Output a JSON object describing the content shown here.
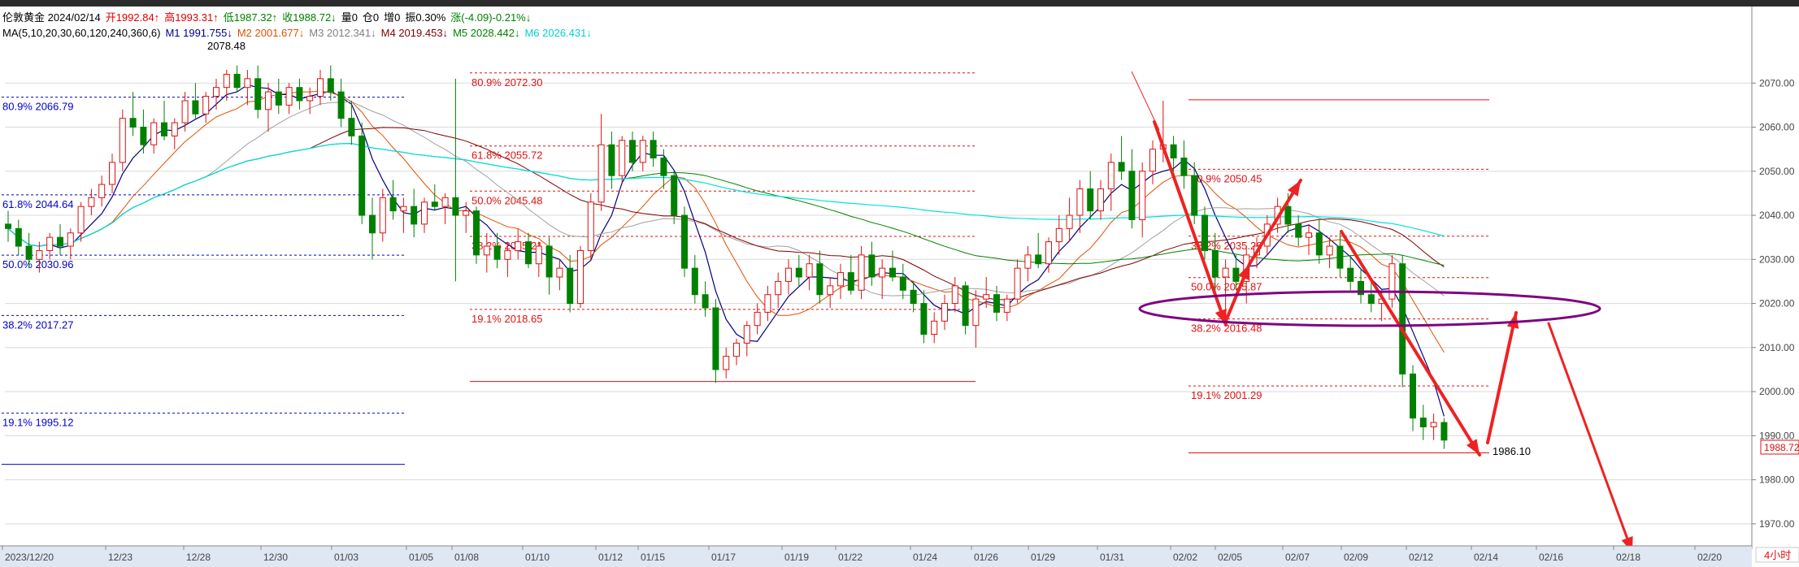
{
  "info": {
    "line1": [
      {
        "text": "伦敦黄金 2024/02/14",
        "color": "#000000"
      },
      {
        "text": "开1992.84↑",
        "color": "#e00000"
      },
      {
        "text": "高1993.31↑",
        "color": "#e00000"
      },
      {
        "text": "低1987.32↑",
        "color": "#008000"
      },
      {
        "text": "收1988.72↓",
        "color": "#008000"
      },
      {
        "text": "量0",
        "color": "#000000"
      },
      {
        "text": "仓0",
        "color": "#000000"
      },
      {
        "text": "增0",
        "color": "#000000"
      },
      {
        "text": "振0.30%",
        "color": "#000000"
      },
      {
        "text": "涨(-4.09)-0.21%↓",
        "color": "#008000"
      }
    ],
    "line2": [
      {
        "text": "MA(5,10,20,30,60,120,240,360,6)",
        "color": "#000000"
      },
      {
        "text": "M1 1991.755↓",
        "color": "#000080"
      },
      {
        "text": "M2 2001.677↓",
        "color": "#e05000"
      },
      {
        "text": "M3 2012.341↓",
        "color": "#808080"
      },
      {
        "text": "M4 2019.453↓",
        "color": "#800000"
      },
      {
        "text": "M5 2028.442↓",
        "color": "#008000"
      },
      {
        "text": "M6 2026.431↓",
        "color": "#00d0d0"
      }
    ]
  },
  "colors": {
    "up": "#e01010",
    "down": "#008000",
    "ma1": "#000080",
    "ma2": "#e05000",
    "ma3": "#a0a0a0",
    "ma4": "#800000",
    "ma5": "#008000",
    "ma6": "#00e0e0",
    "blue_fib": "#0000cc",
    "red_fib": "#e01010",
    "arrow": "#ee2222",
    "ellipse": "#800080",
    "grid": "#d9d9d9"
  },
  "chart_data": {
    "type": "candlestick",
    "ylim": [
      1965,
      2080
    ],
    "y_ticks": [
      "1970.00",
      "1980.00",
      "1990.00",
      "2000.00",
      "2010.00",
      "2020.00",
      "2030.00",
      "2040.00",
      "2050.00",
      "2060.00",
      "2070.00"
    ],
    "x_labels": [
      "2023/12/20",
      "12/23",
      "12/28",
      "12/30",
      "01/03",
      "01/05",
      "01/08",
      "01/10",
      "01/12",
      "01/15",
      "01/17",
      "01/19",
      "01/22",
      "01/24",
      "01/26",
      "01/29",
      "01/31",
      "02/02",
      "02/05",
      "02/07",
      "02/09",
      "02/12",
      "02/14",
      "02/16",
      "02/18",
      "02/20"
    ],
    "last_price": "1988.72",
    "timeframe": "4小时",
    "candles": [
      [
        2038,
        2041,
        2034,
        2037
      ],
      [
        2037,
        2039,
        2031,
        2033
      ],
      [
        2033,
        2036,
        2028,
        2030
      ],
      [
        2030,
        2034,
        2027,
        2032
      ],
      [
        2032,
        2036,
        2030,
        2035
      ],
      [
        2035,
        2038,
        2031,
        2033
      ],
      [
        2033,
        2037,
        2030,
        2036
      ],
      [
        2036,
        2043,
        2034,
        2042
      ],
      [
        2042,
        2046,
        2040,
        2044
      ],
      [
        2044,
        2049,
        2042,
        2047
      ],
      [
        2047,
        2054,
        2045,
        2052
      ],
      [
        2052,
        2064,
        2050,
        2062
      ],
      [
        2062,
        2068,
        2058,
        2060
      ],
      [
        2060,
        2064,
        2054,
        2056
      ],
      [
        2056,
        2062,
        2054,
        2061
      ],
      [
        2061,
        2066,
        2057,
        2058
      ],
      [
        2058,
        2062,
        2055,
        2061
      ],
      [
        2061,
        2068,
        2059,
        2066
      ],
      [
        2066,
        2070,
        2062,
        2063
      ],
      [
        2063,
        2068,
        2061,
        2067
      ],
      [
        2067,
        2071,
        2064,
        2069
      ],
      [
        2069,
        2073,
        2066,
        2072
      ],
      [
        2072,
        2074,
        2068,
        2069
      ],
      [
        2069,
        2073,
        2065,
        2071
      ],
      [
        2071,
        2074,
        2062,
        2064
      ],
      [
        2064,
        2070,
        2059,
        2068
      ],
      [
        2068,
        2071,
        2063,
        2065
      ],
      [
        2065,
        2070,
        2063,
        2069
      ],
      [
        2069,
        2071,
        2064,
        2066
      ],
      [
        2066,
        2069,
        2063,
        2067
      ],
      [
        2067,
        2073,
        2065,
        2071
      ],
      [
        2071,
        2074,
        2066,
        2068
      ],
      [
        2068,
        2071,
        2060,
        2062
      ],
      [
        2062,
        2066,
        2056,
        2058
      ],
      [
        2058,
        2061,
        2038,
        2040
      ],
      [
        2040,
        2044,
        2030,
        2036
      ],
      [
        2036,
        2046,
        2034,
        2044
      ],
      [
        2044,
        2048,
        2039,
        2041
      ],
      [
        2041,
        2044,
        2036,
        2042
      ],
      [
        2042,
        2046,
        2035,
        2038
      ],
      [
        2038,
        2044,
        2036,
        2043
      ],
      [
        2043,
        2047,
        2041,
        2042
      ],
      [
        2042,
        2045,
        2038,
        2044
      ],
      [
        2044,
        2071,
        2025,
        2040
      ],
      [
        2040,
        2043,
        2036,
        2041
      ],
      [
        2041,
        2042,
        2029,
        2031
      ],
      [
        2031,
        2036,
        2027,
        2033
      ],
      [
        2033,
        2036,
        2028,
        2030
      ],
      [
        2030,
        2034,
        2026,
        2032
      ],
      [
        2032,
        2037,
        2030,
        2034
      ],
      [
        2034,
        2036,
        2028,
        2029
      ],
      [
        2029,
        2034,
        2026,
        2033
      ],
      [
        2033,
        2035,
        2022,
        2026
      ],
      [
        2026,
        2030,
        2023,
        2028
      ],
      [
        2028,
        2031,
        2018,
        2020
      ],
      [
        2020,
        2033,
        2019,
        2032
      ],
      [
        2032,
        2045,
        2030,
        2043
      ],
      [
        2043,
        2063,
        2041,
        2056
      ],
      [
        2056,
        2059,
        2046,
        2049
      ],
      [
        2049,
        2058,
        2047,
        2057
      ],
      [
        2057,
        2059,
        2050,
        2052
      ],
      [
        2052,
        2058,
        2050,
        2057
      ],
      [
        2057,
        2059,
        2051,
        2053
      ],
      [
        2053,
        2055,
        2046,
        2049
      ],
      [
        2049,
        2050,
        2038,
        2040
      ],
      [
        2040,
        2042,
        2026,
        2028
      ],
      [
        2028,
        2031,
        2020,
        2022
      ],
      [
        2022,
        2025,
        2017,
        2019
      ],
      [
        2019,
        2021,
        2002,
        2005
      ],
      [
        2005,
        2010,
        2003,
        2008
      ],
      [
        2008,
        2012,
        2006,
        2011
      ],
      [
        2011,
        2016,
        2008,
        2015
      ],
      [
        2015,
        2020,
        2013,
        2018
      ],
      [
        2018,
        2024,
        2016,
        2022
      ],
      [
        2022,
        2027,
        2019,
        2025
      ],
      [
        2025,
        2030,
        2022,
        2028
      ],
      [
        2028,
        2031,
        2024,
        2026
      ],
      [
        2026,
        2031,
        2023,
        2029
      ],
      [
        2029,
        2032,
        2020,
        2022
      ],
      [
        2022,
        2026,
        2019,
        2024
      ],
      [
        2024,
        2029,
        2021,
        2027
      ],
      [
        2027,
        2031,
        2022,
        2023
      ],
      [
        2023,
        2033,
        2021,
        2031
      ],
      [
        2031,
        2034,
        2024,
        2026
      ],
      [
        2026,
        2030,
        2021,
        2028
      ],
      [
        2028,
        2032,
        2025,
        2026
      ],
      [
        2026,
        2029,
        2021,
        2023
      ],
      [
        2023,
        2025,
        2018,
        2020
      ],
      [
        2020,
        2023,
        2011,
        2013
      ],
      [
        2013,
        2018,
        2011,
        2016
      ],
      [
        2016,
        2022,
        2014,
        2020
      ],
      [
        2020,
        2026,
        2018,
        2024
      ],
      [
        2024,
        2025,
        2013,
        2015
      ],
      [
        2015,
        2023,
        2010,
        2021
      ],
      [
        2021,
        2026,
        2019,
        2022
      ],
      [
        2022,
        2024,
        2016,
        2018
      ],
      [
        2018,
        2022,
        2016,
        2021
      ],
      [
        2021,
        2030,
        2020,
        2028
      ],
      [
        2028,
        2033,
        2025,
        2031
      ],
      [
        2031,
        2036,
        2028,
        2029
      ],
      [
        2029,
        2035,
        2027,
        2034
      ],
      [
        2034,
        2040,
        2031,
        2037
      ],
      [
        2037,
        2044,
        2034,
        2040
      ],
      [
        2040,
        2048,
        2036,
        2046
      ],
      [
        2046,
        2050,
        2039,
        2041
      ],
      [
        2041,
        2048,
        2039,
        2046
      ],
      [
        2046,
        2054,
        2041,
        2052
      ],
      [
        2052,
        2058,
        2048,
        2050
      ],
      [
        2050,
        2055,
        2037,
        2039
      ],
      [
        2039,
        2052,
        2035,
        2050
      ],
      [
        2050,
        2057,
        2047,
        2055
      ],
      [
        2055,
        2066,
        2052,
        2056
      ],
      [
        2056,
        2058,
        2050,
        2053
      ],
      [
        2053,
        2057,
        2046,
        2049
      ],
      [
        2049,
        2052,
        2038,
        2040
      ],
      [
        2040,
        2042,
        2030,
        2032
      ],
      [
        2032,
        2036,
        2022,
        2026
      ],
      [
        2026,
        2030,
        2018,
        2028
      ],
      [
        2028,
        2031,
        2023,
        2025
      ],
      [
        2025,
        2033,
        2020,
        2031
      ],
      [
        2031,
        2035,
        2028,
        2033
      ],
      [
        2033,
        2040,
        2031,
        2038
      ],
      [
        2038,
        2044,
        2036,
        2042
      ],
      [
        2042,
        2045,
        2036,
        2038
      ],
      [
        2038,
        2040,
        2033,
        2035
      ],
      [
        2035,
        2038,
        2031,
        2036
      ],
      [
        2036,
        2039,
        2029,
        2031
      ],
      [
        2031,
        2035,
        2028,
        2033
      ],
      [
        2033,
        2036,
        2026,
        2028
      ],
      [
        2028,
        2031,
        2023,
        2025
      ],
      [
        2025,
        2028,
        2020,
        2022
      ],
      [
        2022,
        2025,
        2018,
        2020
      ],
      [
        2020,
        2023,
        2016,
        2021
      ],
      [
        2021,
        2031,
        2019,
        2029
      ],
      [
        2029,
        2031,
        2001,
        2004
      ],
      [
        2004,
        2006,
        1991,
        1994
      ],
      [
        1994,
        1997,
        1989,
        1992
      ],
      [
        1992,
        1995,
        1989,
        1993
      ],
      [
        1993,
        1994,
        1987,
        1989
      ]
    ],
    "fib_levels": [
      {
        "label": "80.9% 2066.79",
        "value": 2066.79,
        "set": "blue"
      },
      {
        "label": "61.8% 2044.64",
        "value": 2044.64,
        "set": "blue"
      },
      {
        "label": "50.0% 2030.96",
        "value": 2030.96,
        "set": "blue"
      },
      {
        "label": "38.2% 2017.27",
        "value": 2017.27,
        "set": "blue"
      },
      {
        "label": "19.1% 1995.12",
        "value": 1995.12,
        "set": "blue"
      },
      {
        "label": "80.9% 2072.30",
        "value": 2072.3,
        "set": "red"
      },
      {
        "label": "61.8% 2055.72",
        "value": 2055.72,
        "set": "red"
      },
      {
        "label": "50.0% 2045.48",
        "value": 2045.48,
        "set": "red"
      },
      {
        "label": "38.2% 2035.21",
        "value": 2035.21,
        "set": "red"
      },
      {
        "label": "19.1% 2018.65",
        "value": 2018.65,
        "set": "red"
      },
      {
        "label": "80.9% 2050.45",
        "value": 2050.45,
        "set": "red2"
      },
      {
        "label": "38.2% 2035.26",
        "value": 2035.26,
        "set": "red2"
      },
      {
        "label": "50.0% 2025.87",
        "value": 2025.87,
        "set": "red2"
      },
      {
        "label": "38.2% 2016.48",
        "value": 2016.48,
        "set": "red2"
      },
      {
        "label": "19.1% 2001.29",
        "value": 2001.29,
        "set": "red2"
      }
    ],
    "annotations": {
      "peak_label": "2078.48",
      "low_label": "1986.10"
    }
  }
}
